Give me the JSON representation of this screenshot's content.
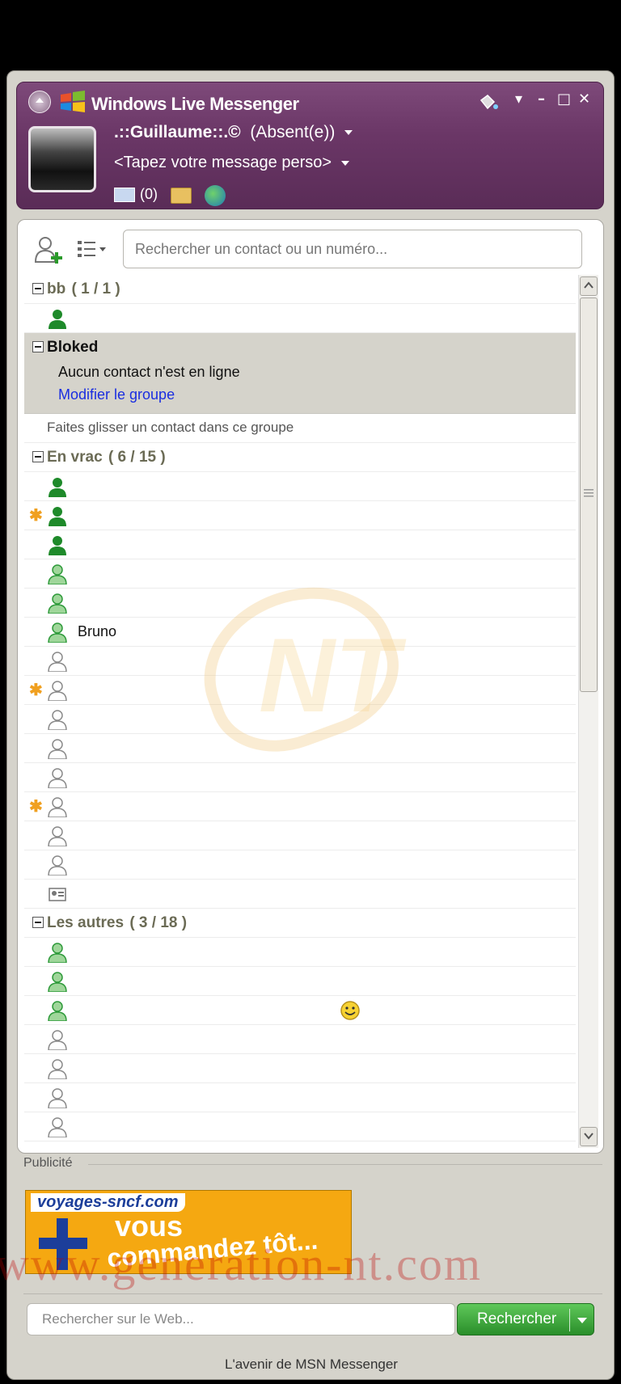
{
  "header": {
    "app_title": "Windows Live Messenger",
    "display_name": ".::Guillaume::.©",
    "status": "(Absent(e))",
    "personal_message": "<Tapez votre message perso>",
    "mail_count": "(0)",
    "window_buttons": [
      "▾",
      "–",
      "□",
      "✕"
    ]
  },
  "toolbar": {
    "search_placeholder": "Rechercher un contact ou un numéro..."
  },
  "groups": {
    "bb": {
      "name": "bb",
      "count": "( 1 / 1 )"
    },
    "bloked": {
      "name": "Bloked",
      "no_contact": "Aucun contact n'est en ligne",
      "edit_group": "Modifier le groupe",
      "drag_hint": "Faites glisser un contact dans ce groupe"
    },
    "envrac": {
      "name": "En vrac",
      "count": "( 6 / 15 )",
      "contact_bruno": "Bruno"
    },
    "autres": {
      "name": "Les autres",
      "count": "( 3 / 18 )"
    }
  },
  "ad": {
    "label": "Publicité",
    "brand": "voyages-sncf.com",
    "line1": "vous",
    "line2": "commandez tôt..."
  },
  "web_search": {
    "placeholder": "Rechercher sur le Web...",
    "button": "Rechercher"
  },
  "footer": "L'avenir de MSN Messenger",
  "watermark": "www.generation-nt.com",
  "colors": {
    "header": "#6b3767",
    "online": "#1e8a2a",
    "offline": "#9a9a9a",
    "link": "#1a2ee0"
  }
}
